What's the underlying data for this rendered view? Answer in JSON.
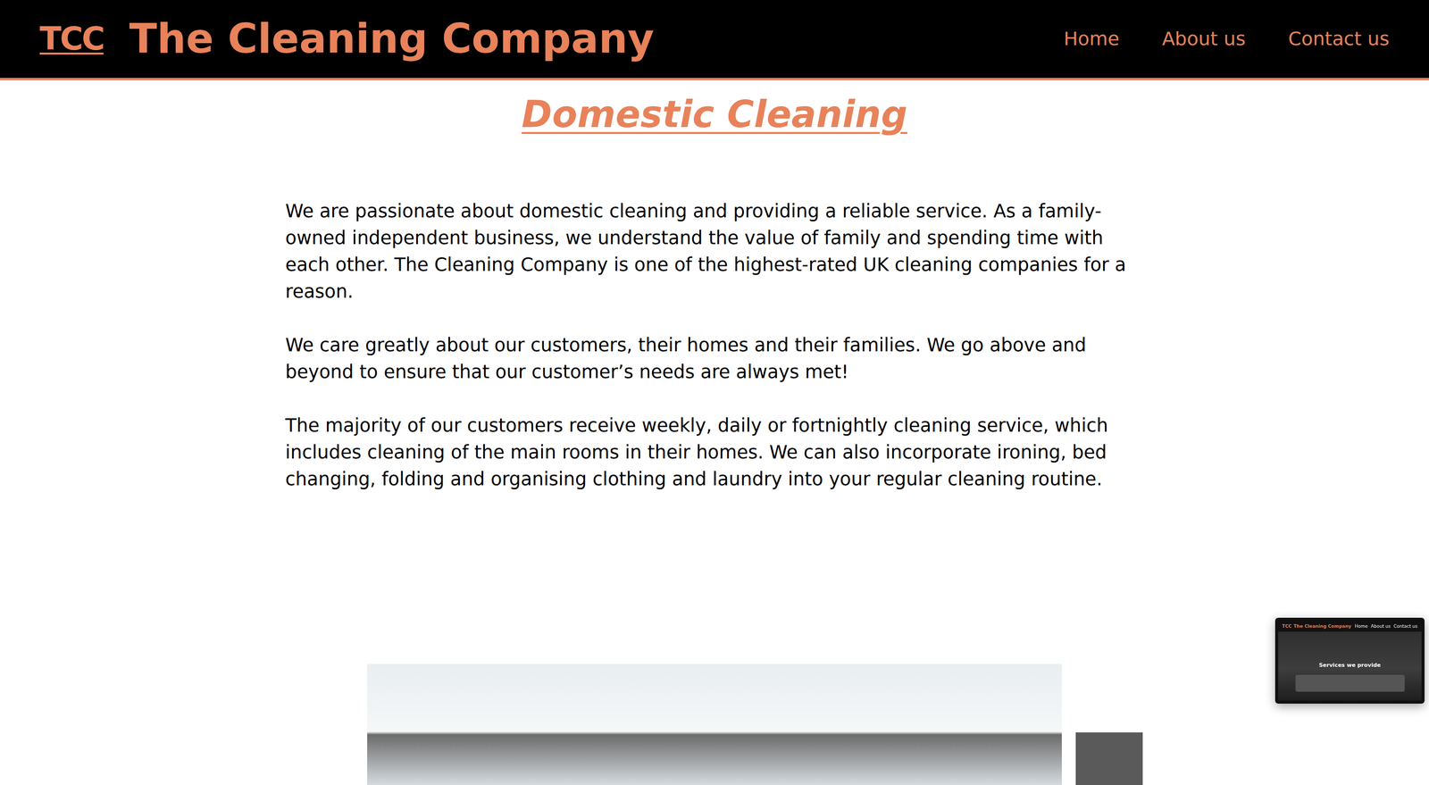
{
  "header": {
    "logo": "TCC",
    "title": "The Cleaning Company",
    "nav": [
      {
        "label": "Home"
      },
      {
        "label": "About us"
      },
      {
        "label": "Contact us"
      }
    ]
  },
  "main": {
    "heading": "Domestic Cleaning",
    "paragraphs": [
      "We are passionate about domestic cleaning and providing a reliable service. As a family-owned independent business, we understand the value of family and spending time with each other. The Cleaning Company is one of the highest-rated UK cleaning companies for a reason.",
      "We care greatly about our customers, their homes and their families. We go above and beyond to ensure that our customer’s needs are always met!",
      "The majority of our customers receive weekly, daily or fortnightly cleaning service, which includes cleaning of the main rooms in their homes. We can also incorporate ironing, bed changing, folding and organising clothing and laundry into your regular cleaning routine."
    ]
  },
  "preview": {
    "logo": "TCC",
    "title": "The Cleaning Company",
    "nav": [
      "Home",
      "About us",
      "Contact us"
    ],
    "caption": "Services we provide"
  }
}
